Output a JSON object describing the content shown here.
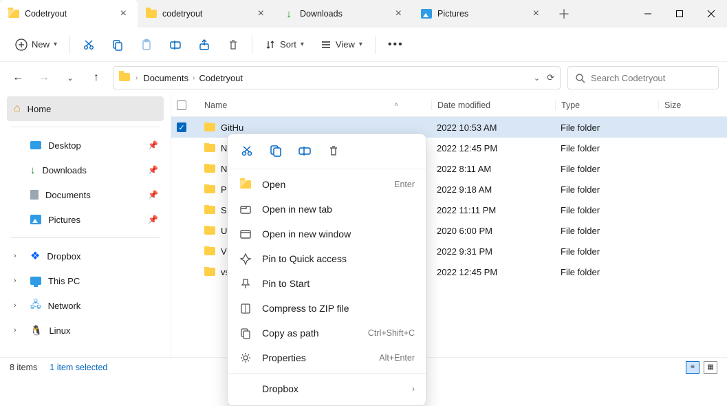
{
  "tabs": [
    {
      "label": "Codetryout",
      "icon": "folder-open"
    },
    {
      "label": "codetryout",
      "icon": "folder"
    },
    {
      "label": "Downloads",
      "icon": "download"
    },
    {
      "label": "Pictures",
      "icon": "picture"
    }
  ],
  "toolbar": {
    "new_label": "New",
    "sort_label": "Sort",
    "view_label": "View"
  },
  "breadcrumb": [
    "Documents",
    "Codetryout"
  ],
  "search": {
    "placeholder": "Search Codetryout"
  },
  "sidebar": {
    "home": "Home",
    "quick": [
      {
        "label": "Desktop",
        "icon": "desktop"
      },
      {
        "label": "Downloads",
        "icon": "download"
      },
      {
        "label": "Documents",
        "icon": "document"
      },
      {
        "label": "Pictures",
        "icon": "picture"
      }
    ],
    "lower": [
      {
        "label": "Dropbox",
        "icon": "dropbox"
      },
      {
        "label": "This PC",
        "icon": "pc"
      },
      {
        "label": "Network",
        "icon": "network"
      },
      {
        "label": "Linux",
        "icon": "linux"
      }
    ]
  },
  "columns": {
    "name": "Name",
    "date": "Date modified",
    "type": "Type",
    "size": "Size"
  },
  "rows": [
    {
      "name": "GitHu",
      "date": "2022 10:53 AM",
      "type": "File folder",
      "selected": true
    },
    {
      "name": "Notes",
      "date": "2022 12:45 PM",
      "type": "File folder"
    },
    {
      "name": "NYtra",
      "date": "2022 8:11 AM",
      "type": "File folder"
    },
    {
      "name": "Powe",
      "date": "2022 9:18 AM",
      "type": "File folder"
    },
    {
      "name": "ShellS",
      "date": "2022 11:11 PM",
      "type": "File folder"
    },
    {
      "name": "Ubunt",
      "date": "2020 6:00 PM",
      "type": "File folder"
    },
    {
      "name": "VM",
      "date": "2022 9:31 PM",
      "type": "File folder"
    },
    {
      "name": "vscod",
      "date": "2022 12:45 PM",
      "type": "File folder"
    }
  ],
  "context_menu": {
    "open": {
      "label": "Open",
      "shortcut": "Enter"
    },
    "open_tab": {
      "label": "Open in new tab"
    },
    "open_window": {
      "label": "Open in new window"
    },
    "pin_quick": {
      "label": "Pin to Quick access"
    },
    "pin_start": {
      "label": "Pin to Start"
    },
    "compress": {
      "label": "Compress to ZIP file"
    },
    "copy_path": {
      "label": "Copy as path",
      "shortcut": "Ctrl+Shift+C"
    },
    "properties": {
      "label": "Properties",
      "shortcut": "Alt+Enter"
    },
    "dropbox": {
      "label": "Dropbox"
    }
  },
  "status": {
    "count": "8 items",
    "selection": "1 item selected"
  }
}
